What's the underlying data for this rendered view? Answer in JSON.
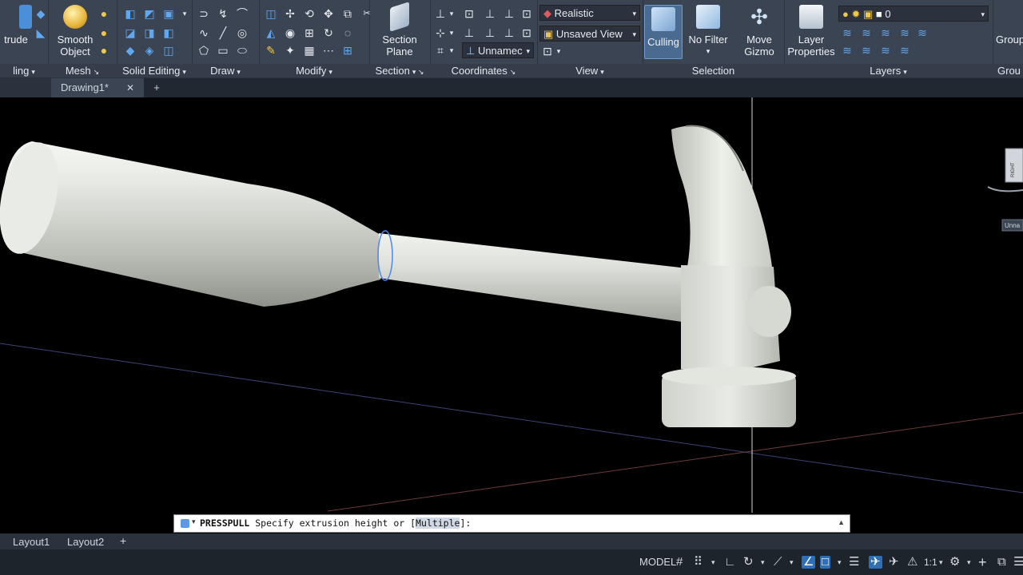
{
  "ribbon": {
    "panels": [
      {
        "title": "ling",
        "arrow": "▾"
      },
      {
        "title": "Mesh",
        "arrow": "↘"
      },
      {
        "title": "Solid Editing",
        "arrow": "▾"
      },
      {
        "title": "Draw",
        "arrow": "▾"
      },
      {
        "title": "Modify",
        "arrow": "▾"
      },
      {
        "title": "Section",
        "arrow": "▾ ↘"
      },
      {
        "title": "Coordinates",
        "arrow": "↘"
      },
      {
        "title": "View",
        "arrow": "▾"
      },
      {
        "title": "Selection",
        "arrow": ""
      },
      {
        "title": "Layers",
        "arrow": "▾"
      },
      {
        "title": "Grou",
        "arrow": ""
      }
    ],
    "extrude_label": "trude",
    "smooth_object_label": "Smooth Object",
    "section_plane_label": "Section Plane",
    "visual_style": "Realistic",
    "saved_view": "Unsaved View",
    "ucs_name": "Unnamec",
    "culling_label": "Culling",
    "no_filter_label": "No Filter",
    "move_gizmo_label": "Move Gizmo",
    "layer_properties_label": "Layer Properties",
    "layer_current": "0",
    "group_label": "Group"
  },
  "tabs": {
    "drawing_tab": "Drawing1*",
    "close_symbol": "✕",
    "add_symbol": "+"
  },
  "viewport": {
    "viewcube_face": "RIGHT",
    "wcs_label": "Unna"
  },
  "command_line": {
    "command": "PRESSPULL",
    "prompt": "Specify extrusion height or [",
    "option": "Multiple",
    "suffix": "]:"
  },
  "layouts": {
    "tab1": "Layout1",
    "tab2": "Layout2",
    "add": "+"
  },
  "status_bar": {
    "model": "MODEL",
    "scale": "1:1"
  },
  "colors": {
    "ribbon_bg": "#3b4453",
    "accent": "#2e6fb8",
    "viewport_bg": "#000000"
  }
}
